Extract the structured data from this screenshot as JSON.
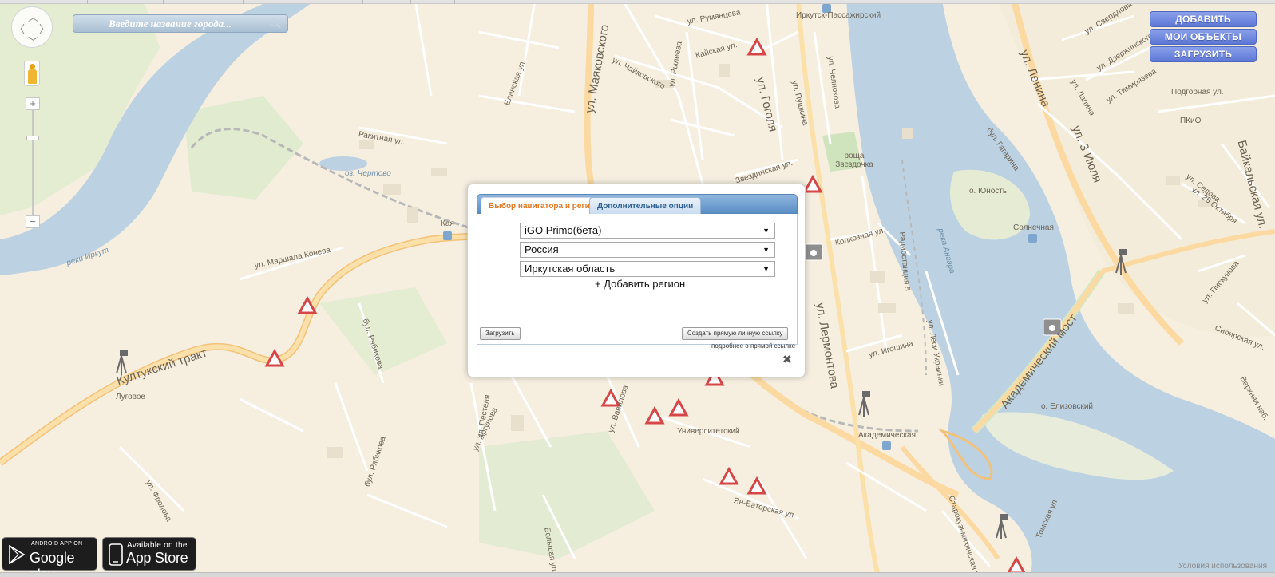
{
  "search": {
    "placeholder": "Введите название города..."
  },
  "buttons": {
    "add": "ДОБАВИТЬ",
    "my_objects": "МОИ ОБЪЕКТЫ",
    "upload": "ЗАГРУЗИТЬ"
  },
  "map": {
    "labels": [
      "реки Иркут",
      "ул. Маяковского",
      "Еланская ул.",
      "ул. Чайковского",
      "ул. Рылеева",
      "ул. Румянцева",
      "Кайская ул.",
      "Иркутск-Пассажирский",
      "ул. Гоголя",
      "ул. Пушкина",
      "ул. Челнокова",
      "ул. Ленина",
      "ул. 3 Июля",
      "Подгорная ул.",
      "ПКиО",
      "Байкальская ул.",
      "Ракитная ул.",
      "оз. Чертово",
      "роща Звездочка",
      "Звездинская ул.",
      "Колхозная ул.",
      "Радиостанция 5",
      "о. Юность",
      "Солнечная",
      "река Ангара",
      "ул. Седова",
      "ул. 25 Октября",
      "ул. Маршала Конева",
      "Кая",
      "ул. Лермонтова",
      "ул. Игошина",
      "ул. Леси Украинки",
      "ул. Пискунова",
      "Сибирская ул.",
      "Академический мост",
      "Култукский тракт",
      "бул. Рябикова",
      "Луговое",
      "ул. Пестеля",
      "ул. Аргунова",
      "ул. Вавилова",
      "Университетский",
      "Академическая",
      "о. Елизовский",
      "Верхняя наб.",
      "ул. Фролова",
      "бул. Рябикова",
      "Ян-Баторская ул.",
      "Старокузьмихинская ул.",
      "Большая ул.",
      "Томская ул.",
      "ул. Дзержинского",
      "ул. Тимирязева",
      "ул. Лапина",
      "ул. Свердлова",
      "бул. Гагарина"
    ]
  },
  "dialog": {
    "tab_active": "Выбор навигатора и региона",
    "tab_other": "Дополнительные опции",
    "navigator": "iGO Primo(бета)",
    "country": "Россия",
    "region": "Иркутская область",
    "add_region": "+ Добавить регион",
    "load_button": "Загрузить",
    "link_button": "Создать прямую личную ссылку",
    "link_note": "подробнее о прямой ссылке"
  },
  "badges": {
    "google_small": "ANDROID APP ON",
    "google_large": "Google play",
    "apple_small": "Available on the",
    "apple_large": "App Store"
  },
  "footer": {
    "terms": "Условия использования"
  }
}
